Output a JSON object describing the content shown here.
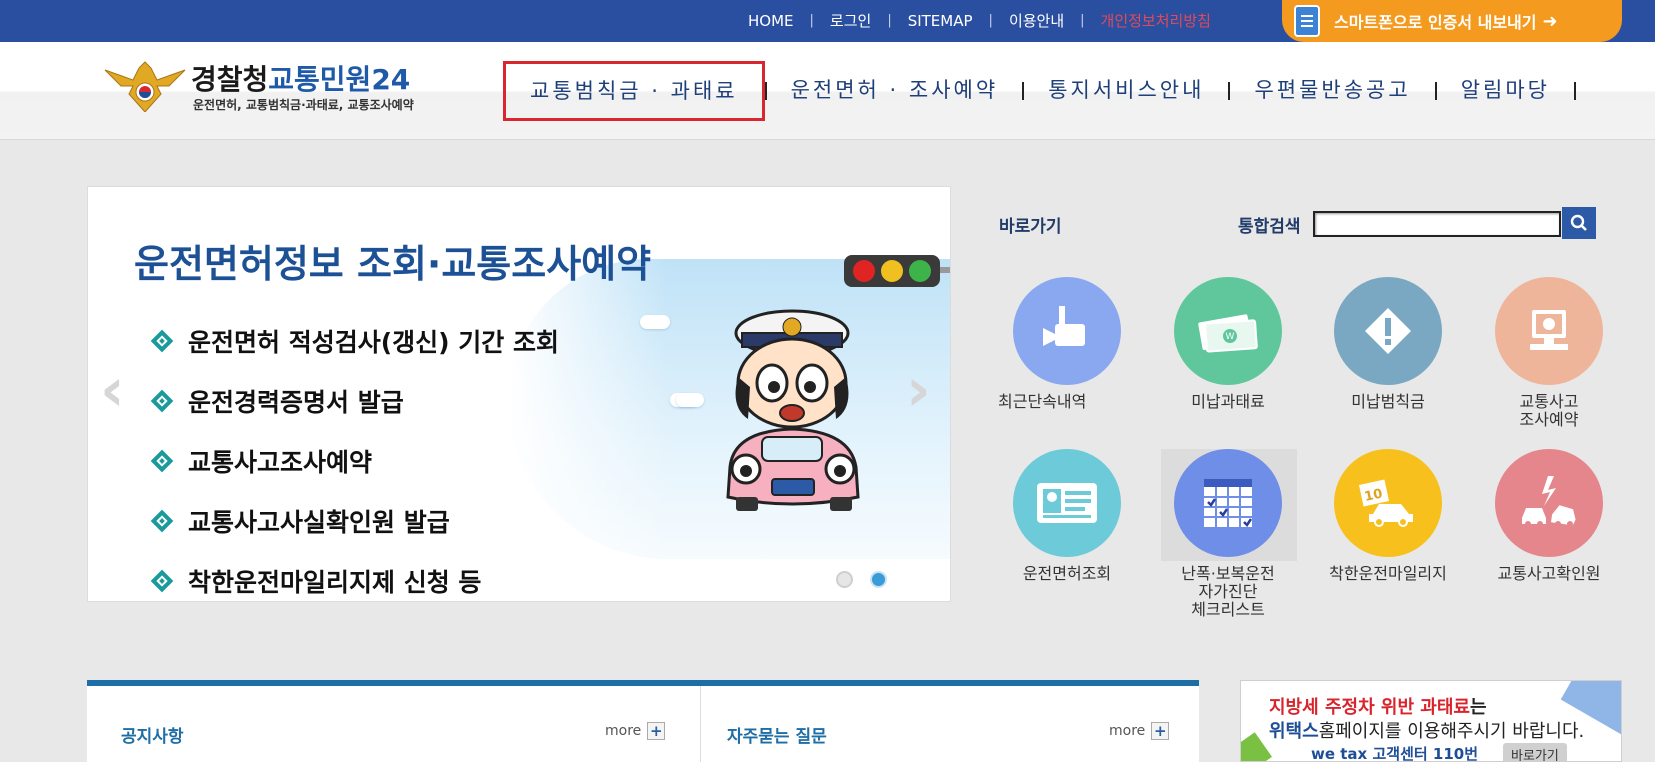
{
  "topbar": {
    "links": [
      "HOME",
      "로그인",
      "SITEMAP",
      "이용안내",
      "개인정보처리방침"
    ],
    "smartphone_button": "스마트폰으로 인증서 내보내기"
  },
  "logo": {
    "title_main": "경찰청",
    "title_sub": "교통민원24",
    "tagline": "운전면허, 교통범칙금·과태료, 교통조사예약"
  },
  "gnb": {
    "items": [
      "교통범칙금 · 과태료",
      "운전면허 · 조사예약",
      "통지서비스안내",
      "우편물반송공고",
      "알림마당"
    ]
  },
  "banner": {
    "title": "운전면허정보 조회·교통조사예약",
    "items": [
      "운전면허 적성검사(갱신) 기간 조회",
      "운전경력증명서 발급",
      "교통사고조사예약",
      "교통사고사실확인원 발급",
      "착한운전마일리지제 신청 등"
    ],
    "active_slide": 2,
    "slide_count": 2
  },
  "quick": {
    "title": "바로가기",
    "search_label": "통합검색",
    "search_value": "",
    "items": [
      {
        "label": "최근단속내역",
        "icon": "camera-icon",
        "color": "#8aa8ef"
      },
      {
        "label": "미납과태료",
        "icon": "money-icon",
        "color": "#5fc79b"
      },
      {
        "label": "미납범칙금",
        "icon": "warning-sign-icon",
        "color": "#7aa8c2"
      },
      {
        "label": "교통사고\n조사예약",
        "icon": "computer-icon",
        "color": "#eeb59a"
      },
      {
        "label": "운전면허조회",
        "icon": "license-card-icon",
        "color": "#6dcad8"
      },
      {
        "label": "난폭·보복운전\n자가진단\n체크리스트",
        "icon": "checklist-icon",
        "color": "#6f8ee8"
      },
      {
        "label": "착한운전마일리지",
        "icon": "mileage-car-icon",
        "color": "#f7c01c"
      },
      {
        "label": "교통사고확인원",
        "icon": "car-crash-icon",
        "color": "#e4868c"
      }
    ]
  },
  "boards": {
    "notice_title": "공지사항",
    "faq_title": "자주묻는 질문",
    "more_label": "more"
  },
  "wetax": {
    "line1_red": "지방세 주정차 위반 과태료",
    "line1_rest": "는",
    "line2_bold": "위택스",
    "line2_rest": "홈페이지를 이용해주시기 바랍니다.",
    "logo_text": "we tax",
    "callcenter": "고객센터 110번",
    "go_label": "바로가기"
  },
  "colors": {
    "topbar": "#2a4fa0",
    "accent_orange": "#f39a1f",
    "gnb_active_border": "#d8272e",
    "banner_title": "#1d5196"
  }
}
